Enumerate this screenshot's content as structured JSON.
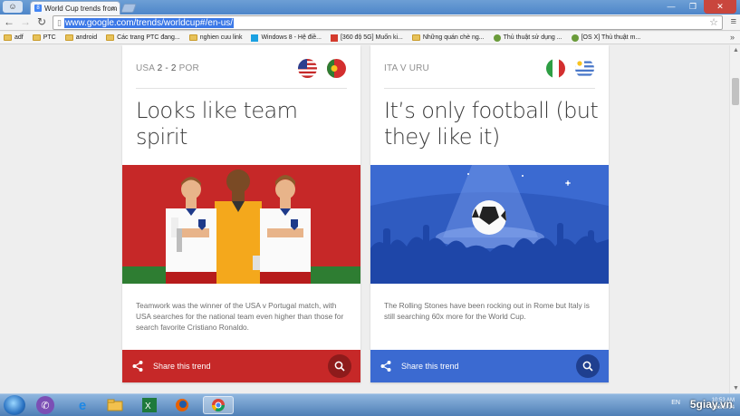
{
  "browser": {
    "tab_title": "World Cup trends from Go",
    "url": "www.google.com/trends/worldcup#/en-us/",
    "menu_label": "≡"
  },
  "bookmarks": [
    {
      "label": "adf",
      "icon": "folder-icon"
    },
    {
      "label": "PTC",
      "icon": "folder-icon"
    },
    {
      "label": "android",
      "icon": "folder-icon"
    },
    {
      "label": "Các trang PTC đang...",
      "icon": "folder-icon"
    },
    {
      "label": "nghien cuu link",
      "icon": "folder-icon"
    },
    {
      "label": "Windows 8 - Hệ điề...",
      "icon": "windows-icon"
    },
    {
      "label": "[360 độ 5G] Muốn ki...",
      "icon": "red-site-icon"
    },
    {
      "label": "Những quán chè ng...",
      "icon": "site-icon"
    },
    {
      "label": "Thủ thuật sử dụng ...",
      "icon": "green-site-icon"
    },
    {
      "label": "[OS X] Thủ thuật m...",
      "icon": "green-site-icon"
    }
  ],
  "cards": [
    {
      "match_teams": "USA",
      "match_score": "2 - 2",
      "match_opponent": "POR",
      "flags": [
        "usa-flag",
        "portugal-flag"
      ],
      "headline": "Looks like team spirit",
      "description": "Teamwork was the winner of the USA v Portugal match, with USA searches for the national team even higher than those for search favorite Cristiano Ronaldo.",
      "share_label": "Share this trend",
      "colors": {
        "illustration_bg": "#c62828",
        "footer": "#c62828"
      }
    },
    {
      "match_teams": "ITA",
      "match_score": "V",
      "match_opponent": "URU",
      "flags": [
        "italy-flag",
        "uruguay-flag"
      ],
      "headline": "It’s only football (but they like it)",
      "description": "The Rolling Stones have been rocking out in Rome but Italy is still searching 60x more for the World Cup.",
      "share_label": "Share this trend",
      "colors": {
        "illustration_bg": "#3b6ad1",
        "footer": "#3b6ad1"
      }
    }
  ],
  "taskbar": {
    "language": "EN",
    "time": "10:53 AM",
    "date": "6/23/2014",
    "watermark": "5giay.vn"
  }
}
